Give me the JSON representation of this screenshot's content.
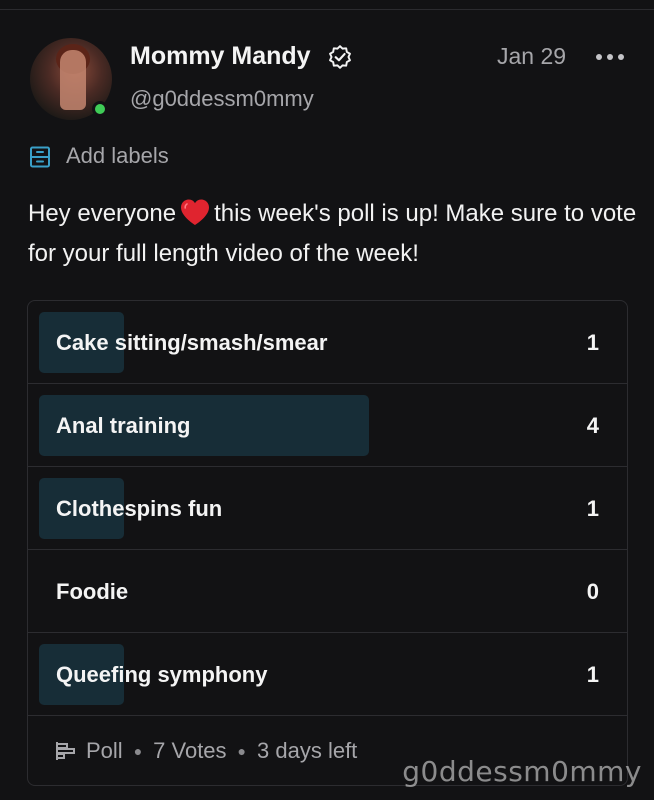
{
  "post": {
    "author_name": "Mommy Mandy",
    "handle": "@g0ddessm0mmy",
    "date": "Jan 29",
    "add_labels": "Add labels",
    "text_before_emoji": "Hey everyone",
    "text_after_emoji": "this week's poll is up! Make sure to vote for your full length video of the week!"
  },
  "poll": {
    "total_votes": 7,
    "options": [
      {
        "label": "Cake sitting/smash/smear",
        "votes": "1",
        "share": 0.14
      },
      {
        "label": "Anal training",
        "votes": "4",
        "share": 0.57
      },
      {
        "label": "Clothespins fun",
        "votes": "1",
        "share": 0.14
      },
      {
        "label": "Foodie",
        "votes": "0",
        "share": 0
      },
      {
        "label": "Queefing symphony",
        "votes": "1",
        "share": 0.14
      }
    ],
    "footer": {
      "type": "Poll",
      "votes_text": "7 Votes",
      "time_left": "3 days left"
    }
  },
  "watermark": "g0ddessm0mmy",
  "colors": {
    "background": "#121214",
    "bar": "#172d37",
    "accent": "#3aa0c8",
    "online": "#3fcc57",
    "heart": "#e0242f"
  },
  "icons": [
    "verified-badge-icon",
    "more-options-icon",
    "labels-icon",
    "heart-emoji-icon",
    "poll-icon"
  ]
}
